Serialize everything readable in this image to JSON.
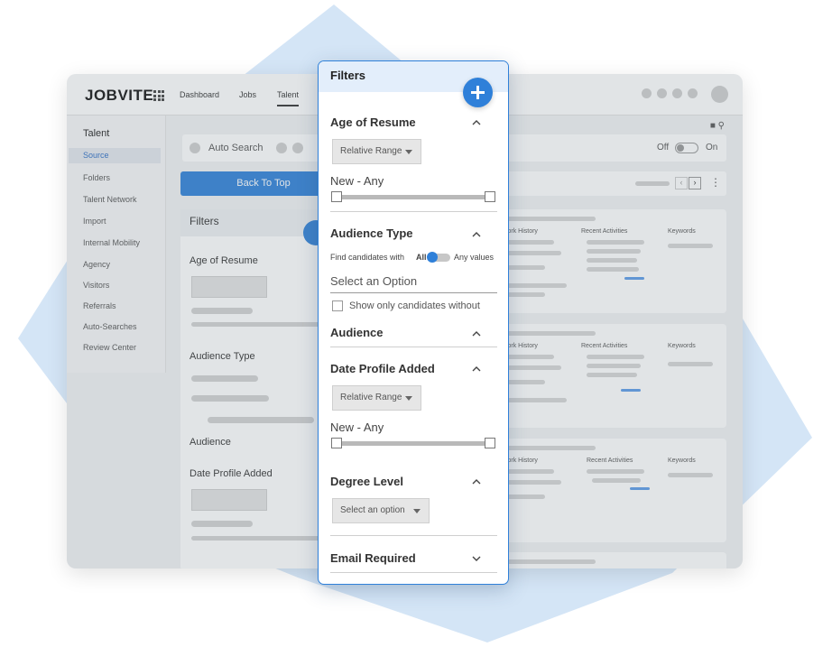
{
  "app": {
    "logo": "JOBVITE",
    "nav": [
      "Dashboard",
      "Jobs",
      "Talent"
    ]
  },
  "sidebar": {
    "title": "Talent",
    "items": [
      "Source",
      "Folders",
      "Talent Network",
      "Import",
      "Internal Mobility",
      "Agency",
      "Visitors",
      "Referrals",
      "Auto-Searches",
      "Review Center"
    ]
  },
  "search_bar": {
    "auto_search": "Auto Search",
    "toggle_off": "Off",
    "toggle_on": "On"
  },
  "back_to_top": "Back To Top",
  "bg_filters": {
    "title": "Filters",
    "sections": [
      "Age of Resume",
      "Audience Type",
      "Audience",
      "Date Profile Added"
    ]
  },
  "cards": {
    "col1": "Work History",
    "col2": "Recent Activities",
    "col3": "Keywords"
  },
  "filters_panel": {
    "title": "Filters",
    "age_of_resume": {
      "label": "Age of Resume",
      "dropdown": "Relative Range",
      "range": "New - Any"
    },
    "audience_type": {
      "label": "Audience Type",
      "find_text": "Find candidates with",
      "all": "All",
      "any_values": "Any values",
      "select_option": "Select an Option",
      "show_only": "Show only candidates without"
    },
    "audience": {
      "label": "Audience"
    },
    "date_profile_added": {
      "label": "Date Profile Added",
      "dropdown": "Relative Range",
      "range": "New - Any"
    },
    "degree_level": {
      "label": "Degree Level",
      "dropdown": "Select an option"
    },
    "email_required": {
      "label": "Email Required"
    }
  },
  "colors": {
    "accent": "#2f80d9",
    "background_shape": "#d4e5f6"
  }
}
